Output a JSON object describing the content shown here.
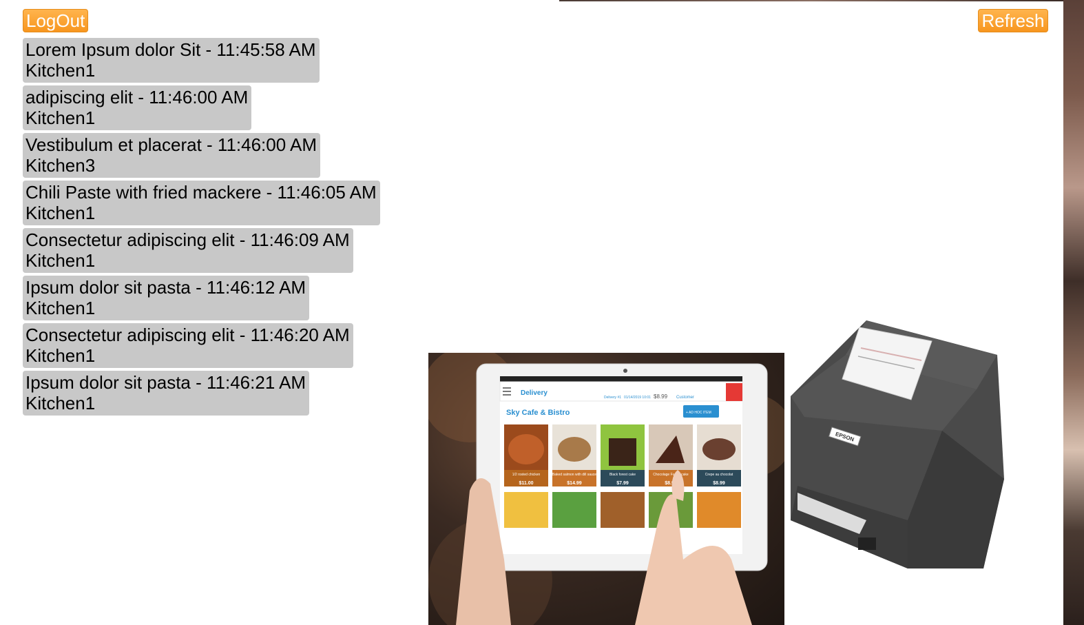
{
  "header": {
    "logout_label": "LogOut",
    "refresh_label": "Refresh"
  },
  "orders": [
    {
      "text": "Lorem Ipsum dolor Sit - 11:45:58 AM",
      "kitchen": "Kitchen1"
    },
    {
      "text": "adipiscing elit - 11:46:00 AM",
      "kitchen": "Kitchen1"
    },
    {
      "text": "Vestibulum et placerat - 11:46:00 AM",
      "kitchen": "Kitchen3"
    },
    {
      "text": "Chili Paste with fried mackere - 11:46:05 AM",
      "kitchen": "Kitchen1"
    },
    {
      "text": "Consectetur adipiscing elit - 11:46:09 AM",
      "kitchen": "Kitchen1"
    },
    {
      "text": "Ipsum dolor sit pasta - 11:46:12 AM",
      "kitchen": "Kitchen1"
    },
    {
      "text": "Consectetur adipiscing elit - 11:46:20 AM",
      "kitchen": "Kitchen1"
    },
    {
      "text": "Ipsum dolor sit pasta - 11:46:21 AM",
      "kitchen": "Kitchen1"
    }
  ],
  "illustration": {
    "app_tabs": [
      "Delivery",
      "Delivery #1",
      "01/14/2019 10:01",
      "$8.99",
      "Customer"
    ],
    "restaurant_name": "Sky Cafe & Bistro",
    "add_button_label": "+ AD HOC ITEM",
    "menu_items": [
      {
        "name": "1/2 rosted chicken",
        "price": "$11.00",
        "color": "#b5651d"
      },
      {
        "name": "Baked salmon with dill sauce",
        "price": "$14.99",
        "color": "#c8732a"
      },
      {
        "name": "Black forest cake",
        "price": "$7.99",
        "color": "#2c4a5a"
      },
      {
        "name": "Chocolage Fudge cake",
        "price": "$8.99",
        "color": "#c8732a"
      },
      {
        "name": "Crepe au chocolat",
        "price": "$8.99",
        "color": "#2c4a5a"
      }
    ],
    "printer_brand": "EPSON"
  },
  "colors": {
    "button": "#f7961f",
    "order_bg": "#c8c8c8",
    "accent_blue": "#2a8fd0"
  }
}
